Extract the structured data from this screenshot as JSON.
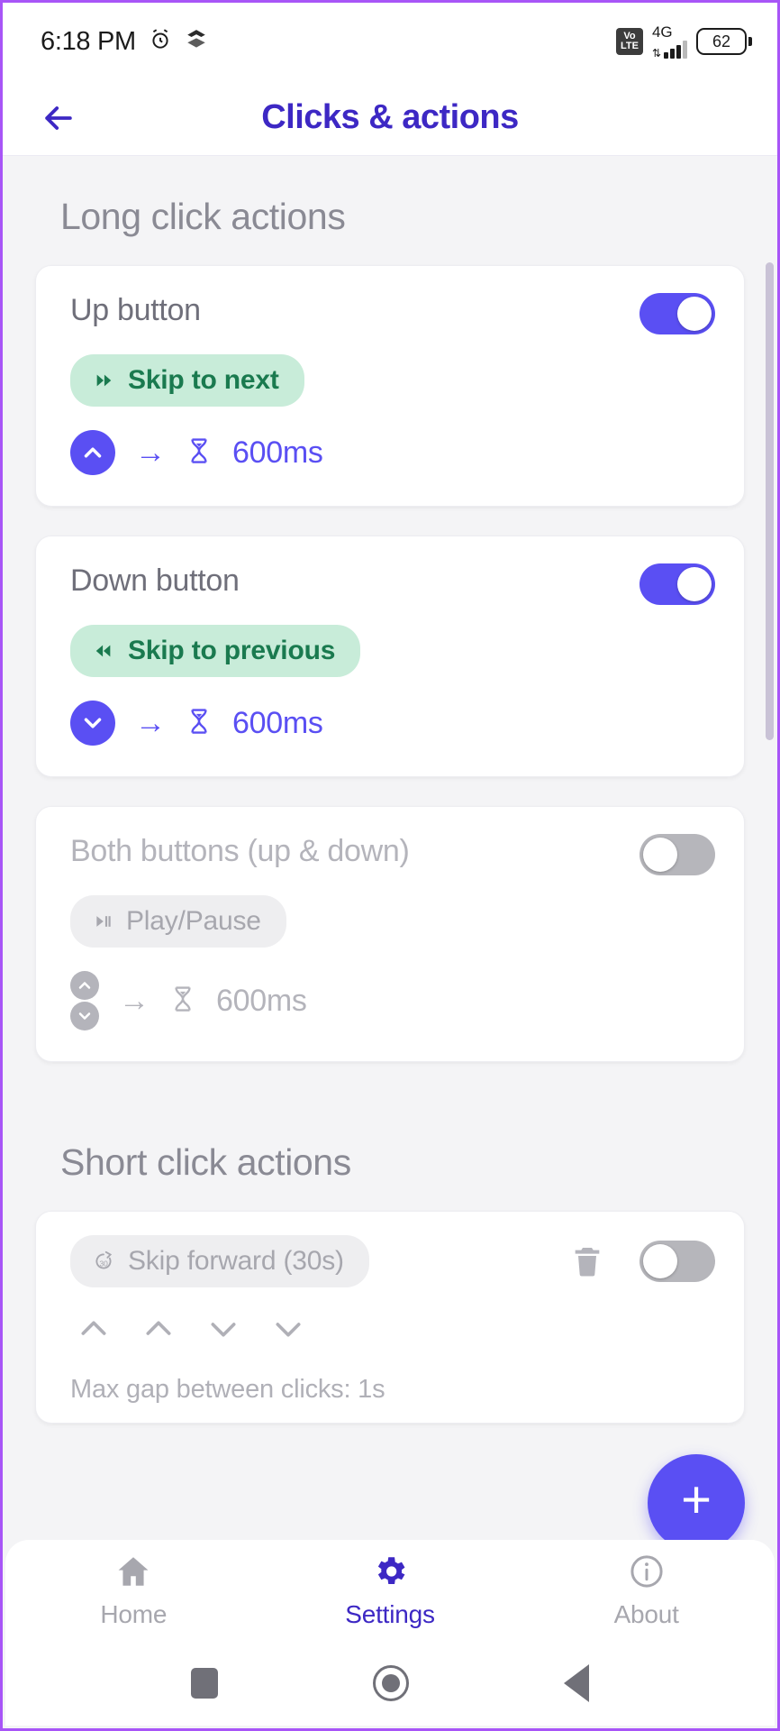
{
  "statusbar": {
    "time": "6:18 PM",
    "alarm_icon": "alarm-icon",
    "app_icon": "app-notification-icon",
    "volte_top": "Vo",
    "volte_bottom": "LTE",
    "network_generation": "4G",
    "data_arrows": "⇅",
    "battery_level": "62"
  },
  "appbar": {
    "back_icon": "back-arrow-icon",
    "title": "Clicks & actions"
  },
  "sections": {
    "long_click_title": "Long click actions",
    "short_click_title": "Short click actions"
  },
  "long_click_cards": [
    {
      "title": "Up button",
      "enabled": true,
      "toggle_state": "on",
      "chip_label": "Skip to next",
      "chip_icon": "skip-forward-icon",
      "button_icon": "chevron-up-icon",
      "arrow_icon": "arrow-right-icon",
      "delay_icon": "hourglass-icon",
      "delay": "600ms"
    },
    {
      "title": "Down button",
      "enabled": true,
      "toggle_state": "on",
      "chip_label": "Skip to previous",
      "chip_icon": "skip-backward-icon",
      "button_icon": "chevron-down-icon",
      "arrow_icon": "arrow-right-icon",
      "delay_icon": "hourglass-icon",
      "delay": "600ms"
    },
    {
      "title": "Both buttons (up & down)",
      "enabled": false,
      "toggle_state": "off",
      "chip_label": "Play/Pause",
      "chip_icon": "play-pause-icon",
      "button_icon": "chevron-up-down-icon",
      "arrow_icon": "arrow-right-icon",
      "delay_icon": "hourglass-icon",
      "delay": "600ms"
    }
  ],
  "short_click_card": {
    "chip_label": "Skip forward (30s)",
    "chip_icon": "skip-forward-30-icon",
    "delete_icon": "trash-icon",
    "toggle_state": "off",
    "sequence": [
      "chevron-up-icon",
      "chevron-up-icon",
      "chevron-down-icon",
      "chevron-down-icon"
    ],
    "max_gap_label": "Max gap between clicks: 1s"
  },
  "fab": {
    "icon": "plus-icon",
    "label": "+"
  },
  "bottom_nav": [
    {
      "label": "Home",
      "icon": "home-icon",
      "active": false
    },
    {
      "label": "Settings",
      "icon": "gear-icon",
      "active": true
    },
    {
      "label": "About",
      "icon": "info-icon",
      "active": false
    }
  ],
  "system_nav": [
    {
      "icon": "recents-square-icon"
    },
    {
      "icon": "home-circle-icon"
    },
    {
      "icon": "back-triangle-icon"
    }
  ],
  "colors": {
    "accent_purple": "#5a4ff3",
    "title_purple": "#3d28c4",
    "chip_green_bg": "#c8ecd9",
    "chip_green_text": "#1a7a4f",
    "disabled_grey": "#b4b4bb",
    "page_bg": "#f4f4f6"
  }
}
